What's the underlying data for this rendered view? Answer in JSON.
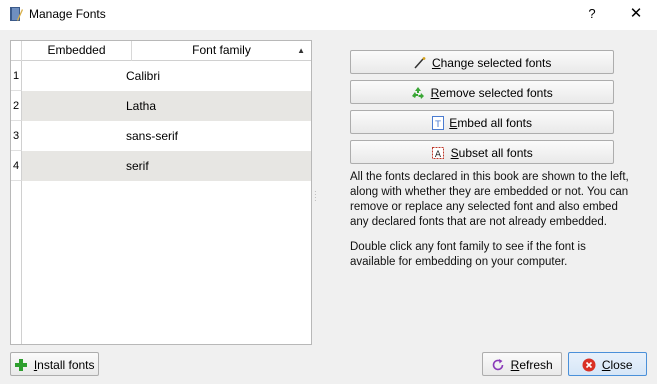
{
  "window": {
    "title": "Manage Fonts",
    "help_label": "?",
    "close_glyph": "✕"
  },
  "table": {
    "columns": [
      "Embedded",
      "Font family"
    ],
    "sort_indicator": "▲",
    "rows": [
      {
        "num": "1",
        "embedded": "",
        "family": "Calibri"
      },
      {
        "num": "2",
        "embedded": "",
        "family": "Latha"
      },
      {
        "num": "3",
        "embedded": "",
        "family": "sans-serif"
      },
      {
        "num": "4",
        "embedded": "",
        "family": "serif"
      }
    ]
  },
  "actions": {
    "change": {
      "accel": "C",
      "rest": "hange selected fonts",
      "icon": "wand-icon"
    },
    "remove": {
      "accel": "R",
      "rest": "emove selected fonts",
      "icon": "recycle-icon"
    },
    "embed": {
      "accel": "E",
      "rest": "mbed all fonts",
      "icon": "embed-icon"
    },
    "subset": {
      "accel": "S",
      "rest": "ubset all fonts",
      "icon": "subset-icon"
    }
  },
  "description": {
    "p1": "All the fonts declared in this book are shown to the left, along with whether they are embedded or not. You can remove or replace any selected font and also embed any declared fonts that are not already embedded.",
    "p2": "Double click any font family to see if the font is available for embedding on your computer."
  },
  "footer": {
    "install": {
      "accel": "I",
      "rest": "nstall fonts",
      "icon": "plus-icon"
    },
    "refresh": {
      "accel": "R",
      "rest": "efresh",
      "icon": "refresh-icon"
    },
    "close": {
      "accel": "C",
      "rest": "lose",
      "icon": "close-circle-icon"
    }
  },
  "colors": {
    "alt_row": "#e7e6e3",
    "install_green": "#2e9e2e",
    "close_red": "#d93025",
    "refresh_purple": "#8a3ab9",
    "recycle_green": "#3aa635"
  }
}
